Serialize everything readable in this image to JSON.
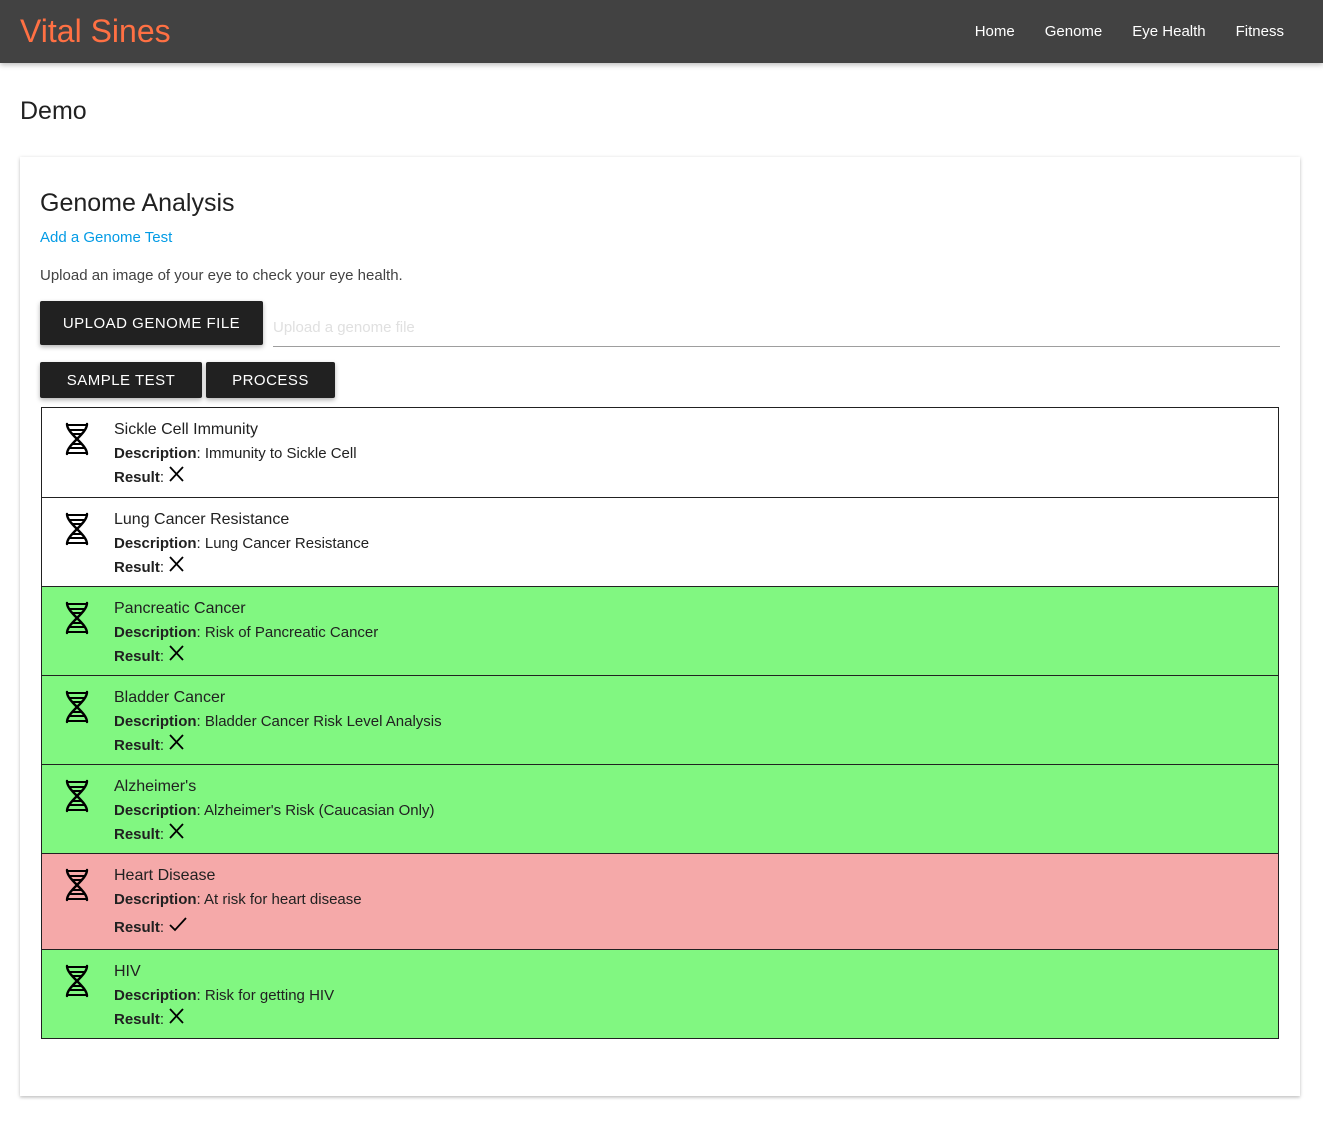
{
  "navbar": {
    "brand": "Vital Sines",
    "links": [
      {
        "label": "Home"
      },
      {
        "label": "Genome"
      },
      {
        "label": "Eye Health"
      },
      {
        "label": "Fitness"
      }
    ]
  },
  "page_title": "Demo",
  "card": {
    "title": "Genome Analysis",
    "add_link": "Add a Genome Test",
    "hint": "Upload an image of your eye to check your eye health.",
    "upload_button": "UPLOAD GENOME FILE",
    "file_placeholder": "Upload a genome file",
    "sample_button": "SAMPLE TEST",
    "process_button": "PROCESS"
  },
  "labels": {
    "description": "Description",
    "result": "Result"
  },
  "colors": {
    "brand": "#ff7043",
    "navbar": "#424242",
    "link": "#039be5",
    "good_row": "#81f781",
    "bad_row": "#f5a9a9",
    "neutral_row": "#ffffff"
  },
  "tests": [
    {
      "name": "Sickle Cell Immunity",
      "description": "Immunity to Sickle Cell",
      "result_icon": "x-icon",
      "status": "neutral"
    },
    {
      "name": "Lung Cancer Resistance",
      "description": "Lung Cancer Resistance",
      "result_icon": "x-icon",
      "status": "neutral"
    },
    {
      "name": "Pancreatic Cancer",
      "description": "Risk of Pancreatic Cancer",
      "result_icon": "x-icon",
      "status": "good"
    },
    {
      "name": "Bladder Cancer",
      "description": "Bladder Cancer Risk Level Analysis",
      "result_icon": "x-icon",
      "status": "good"
    },
    {
      "name": "Alzheimer's",
      "description": "Alzheimer's Risk (Caucasian Only)",
      "result_icon": "x-icon",
      "status": "good"
    },
    {
      "name": "Heart Disease",
      "description": "At risk for heart disease",
      "result_icon": "check-icon",
      "status": "bad"
    },
    {
      "name": "HIV",
      "description": "Risk for getting HIV",
      "result_icon": "x-icon",
      "status": "good"
    }
  ]
}
